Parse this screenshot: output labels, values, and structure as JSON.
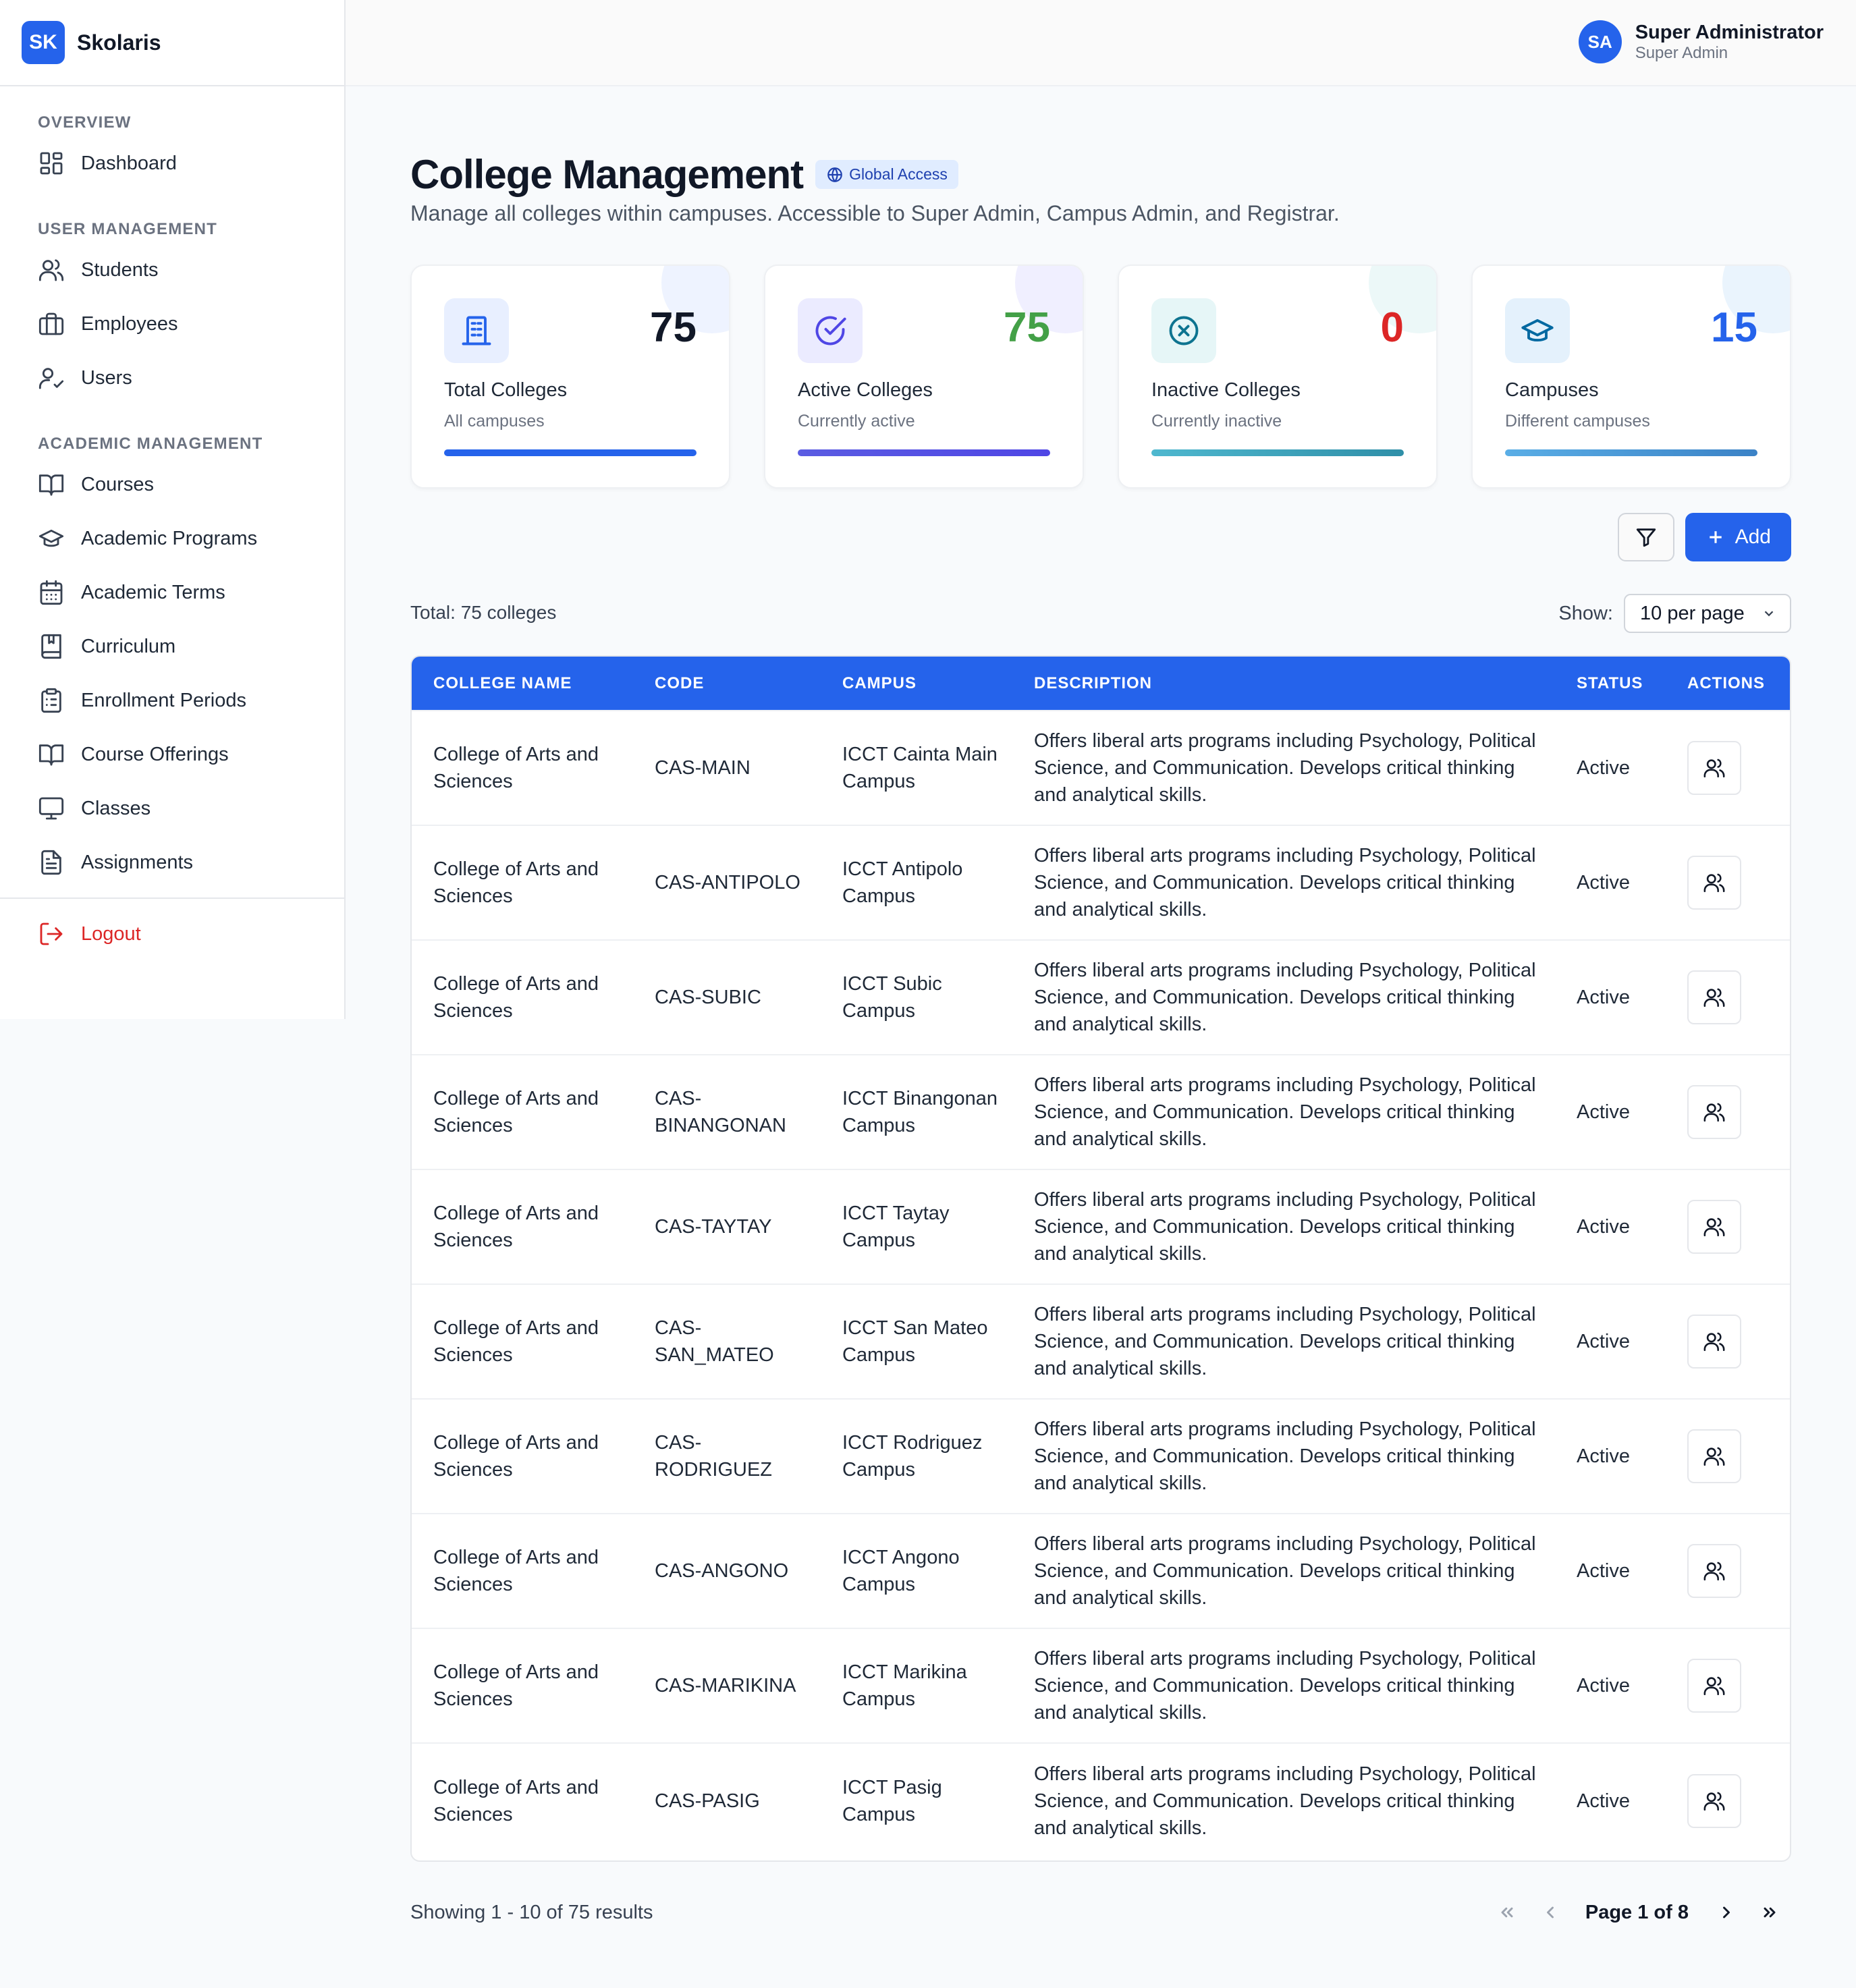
{
  "app": {
    "logo": "SK",
    "name": "Skolaris"
  },
  "user": {
    "initials": "SA",
    "name": "Super Administrator",
    "role": "Super Admin"
  },
  "sidebar": {
    "sections": [
      {
        "title": "OVERVIEW",
        "items": [
          {
            "label": "Dashboard",
            "icon": "dashboard-icon"
          }
        ]
      },
      {
        "title": "USER MANAGEMENT",
        "items": [
          {
            "label": "Students",
            "icon": "users-icon"
          },
          {
            "label": "Employees",
            "icon": "briefcase-icon"
          },
          {
            "label": "Users",
            "icon": "user-check-icon"
          }
        ]
      },
      {
        "title": "ACADEMIC MANAGEMENT",
        "items": [
          {
            "label": "Courses",
            "icon": "book-open-icon"
          },
          {
            "label": "Academic Programs",
            "icon": "graduation-cap-icon"
          },
          {
            "label": "Academic Terms",
            "icon": "calendar-icon"
          },
          {
            "label": "Curriculum",
            "icon": "bookmark-book-icon"
          },
          {
            "label": "Enrollment Periods",
            "icon": "clipboard-list-icon"
          },
          {
            "label": "Course Offerings",
            "icon": "book-open-icon"
          },
          {
            "label": "Classes",
            "icon": "monitor-icon"
          },
          {
            "label": "Assignments",
            "icon": "file-text-icon"
          }
        ]
      }
    ],
    "logout": "Logout"
  },
  "page": {
    "title": "College Management",
    "badge": "Global Access",
    "subtitle": "Manage all colleges within campuses. Accessible to Super Admin, Campus Admin, and Registrar."
  },
  "stats": [
    {
      "value": "75",
      "label": "Total Colleges",
      "sub": "All campuses",
      "color": "#111827",
      "icon": "building-icon"
    },
    {
      "value": "75",
      "label": "Active Colleges",
      "sub": "Currently active",
      "color": "#43a047",
      "icon": "check-circle-icon"
    },
    {
      "value": "0",
      "label": "Inactive Colleges",
      "sub": "Currently inactive",
      "color": "#dc2626",
      "icon": "x-circle-icon"
    },
    {
      "value": "15",
      "label": "Campuses",
      "sub": "Different campuses",
      "color": "#2563eb",
      "icon": "graduation-cap-icon"
    }
  ],
  "toolbar": {
    "add_label": "Add"
  },
  "list": {
    "total": "Total: 75 colleges",
    "show_label": "Show:",
    "per_page": "10 per page"
  },
  "table": {
    "headers": [
      "COLLEGE NAME",
      "CODE",
      "CAMPUS",
      "DESCRIPTION",
      "STATUS",
      "ACTIONS"
    ],
    "rows": [
      {
        "name": "College of Arts and Sciences",
        "code": "CAS-MAIN",
        "campus": "ICCT Cainta Main Campus",
        "description": "Offers liberal arts programs including Psychology, Political Science, and Communication. Develops critical thinking and analytical skills.",
        "status": "Active"
      },
      {
        "name": "College of Arts and Sciences",
        "code": "CAS-ANTIPOLO",
        "campus": "ICCT Antipolo Campus",
        "description": "Offers liberal arts programs including Psychology, Political Science, and Communication. Develops critical thinking and analytical skills.",
        "status": "Active"
      },
      {
        "name": "College of Arts and Sciences",
        "code": "CAS-SUBIC",
        "campus": "ICCT Subic Campus",
        "description": "Offers liberal arts programs including Psychology, Political Science, and Communication. Develops critical thinking and analytical skills.",
        "status": "Active"
      },
      {
        "name": "College of Arts and Sciences",
        "code": "CAS-BINANGONAN",
        "campus": "ICCT Binangonan Campus",
        "description": "Offers liberal arts programs including Psychology, Political Science, and Communication. Develops critical thinking and analytical skills.",
        "status": "Active"
      },
      {
        "name": "College of Arts and Sciences",
        "code": "CAS-TAYTAY",
        "campus": "ICCT Taytay Campus",
        "description": "Offers liberal arts programs including Psychology, Political Science, and Communication. Develops critical thinking and analytical skills.",
        "status": "Active"
      },
      {
        "name": "College of Arts and Sciences",
        "code": "CAS-SAN_MATEO",
        "campus": "ICCT San Mateo Campus",
        "description": "Offers liberal arts programs including Psychology, Political Science, and Communication. Develops critical thinking and analytical skills.",
        "status": "Active"
      },
      {
        "name": "College of Arts and Sciences",
        "code": "CAS-RODRIGUEZ",
        "campus": "ICCT Rodriguez Campus",
        "description": "Offers liberal arts programs including Psychology, Political Science, and Communication. Develops critical thinking and analytical skills.",
        "status": "Active"
      },
      {
        "name": "College of Arts and Sciences",
        "code": "CAS-ANGONO",
        "campus": "ICCT Angono Campus",
        "description": "Offers liberal arts programs including Psychology, Political Science, and Communication. Develops critical thinking and analytical skills.",
        "status": "Active"
      },
      {
        "name": "College of Arts and Sciences",
        "code": "CAS-MARIKINA",
        "campus": "ICCT Marikina Campus",
        "description": "Offers liberal arts programs including Psychology, Political Science, and Communication. Develops critical thinking and analytical skills.",
        "status": "Active"
      },
      {
        "name": "College of Arts and Sciences",
        "code": "CAS-PASIG",
        "campus": "ICCT Pasig Campus",
        "description": "Offers liberal arts programs including Psychology, Political Science, and Communication. Develops critical thinking and analytical skills.",
        "status": "Active"
      }
    ]
  },
  "pagination": {
    "showing": "Showing 1 - 10 of 75 results",
    "page": "Page 1 of 8"
  },
  "colors": {
    "accent": "#2563eb",
    "danger": "#dc2626",
    "success": "#43a047"
  }
}
